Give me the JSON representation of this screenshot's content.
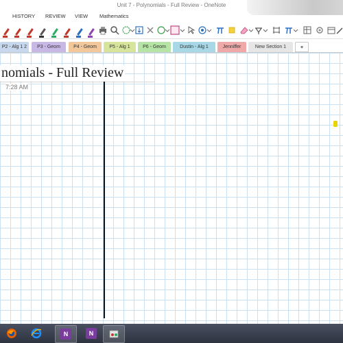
{
  "window": {
    "title": "Unit 7 - Polynomials - Full Review - OneNote"
  },
  "ribbon_tabs": [
    {
      "label": "HISTORY"
    },
    {
      "label": "REVIEW"
    },
    {
      "label": "VIEW"
    },
    {
      "label": "Mathematics"
    }
  ],
  "sections": [
    {
      "label": "P2 - Alg 1 2",
      "color": "#c7d8ee"
    },
    {
      "label": "P3 - Geom",
      "color": "#c8b8e6"
    },
    {
      "label": "P4 - Geom",
      "color": "#f2c79a"
    },
    {
      "label": "P5 - Alg 1",
      "color": "#d7e59c"
    },
    {
      "label": "P6 - Geom",
      "color": "#b6e3a6"
    },
    {
      "label": "Dustin - Alg 1",
      "color": "#a8d8e6"
    },
    {
      "label": "Jenniffer",
      "color": "#f0a9a9"
    },
    {
      "label": "New Section 1",
      "color": "#e6e6e6"
    },
    {
      "label": "+",
      "color": "#ffffff"
    }
  ],
  "page": {
    "title": "nomials - Full Review",
    "time": "7:28 AM"
  },
  "taskbar": [
    {
      "name": "firefox"
    },
    {
      "name": "internet-explorer"
    },
    {
      "name": "onenote"
    },
    {
      "name": "onenote-2"
    },
    {
      "name": "snipping-tool"
    }
  ],
  "colors": {
    "grid": "#c9dff2",
    "taskbar": "#3a404e"
  }
}
